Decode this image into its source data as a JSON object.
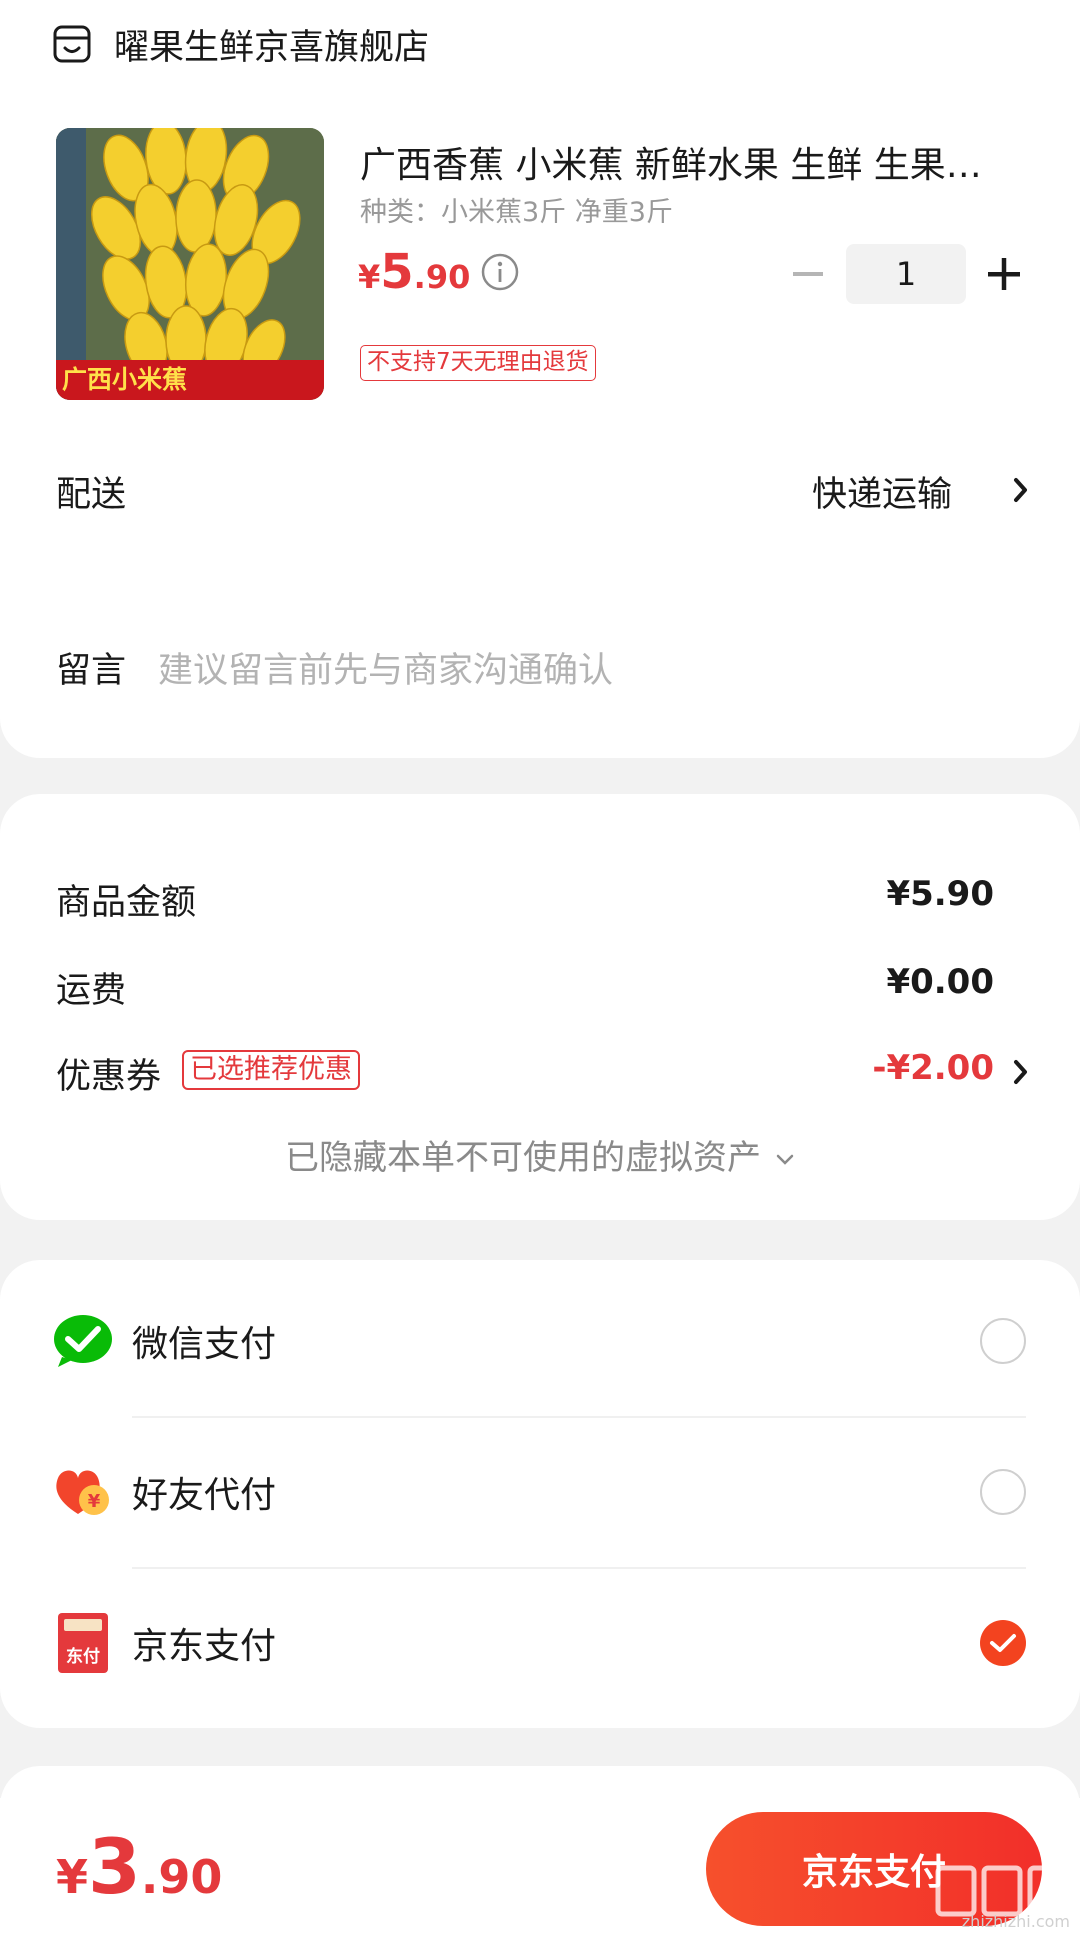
{
  "store": {
    "name": "曜果生鲜京喜旗舰店",
    "icon": "store-icon"
  },
  "product": {
    "title": "广西香蕉 小米蕉 新鲜水果 生鲜 生果…",
    "spec": "种类：小米蕉3斤 净重3斤",
    "image_caption": "广西小米蕉",
    "price_yen": "¥",
    "price_int": "5",
    "price_dec": ".90",
    "quantity": "1",
    "return_policy_tag": "不支持7天无理由退货"
  },
  "delivery": {
    "label": "配送",
    "value": "快递运输"
  },
  "message": {
    "label": "留言",
    "placeholder": "建议留言前先与商家沟通确认"
  },
  "summary": {
    "goods_label": "商品金额",
    "goods_value": "¥5.90",
    "shipping_label": "运费",
    "shipping_value": "¥0.00",
    "coupon_label": "优惠券",
    "coupon_tag": "已选推荐优惠",
    "coupon_value": "-¥2.00",
    "hidden_assets": "已隐藏本单不可使用的虚拟资产"
  },
  "payment": {
    "methods": [
      {
        "label": "微信支付",
        "icon": "wechat-pay-icon",
        "selected": false
      },
      {
        "label": "好友代付",
        "icon": "friend-pay-heart-icon",
        "selected": false
      },
      {
        "label": "京东支付",
        "icon": "jd-pay-icon",
        "icon_text": "东付",
        "selected": true
      }
    ]
  },
  "footer": {
    "total_yen": "¥",
    "total_int": "3",
    "total_dec": ".90",
    "pay_button": "京东支付"
  },
  "watermark": {
    "text": "zhizhizhi.com"
  },
  "colors": {
    "accent": "#e4393c",
    "button": "#f3431f",
    "wechat": "#09bb07"
  }
}
